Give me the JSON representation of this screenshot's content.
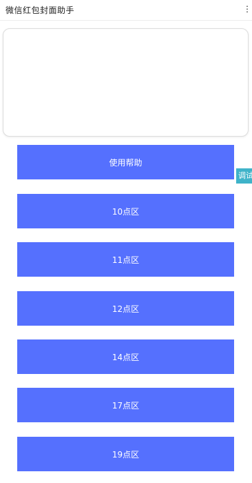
{
  "header": {
    "title": "微信红包封面助手",
    "more_glyph": "⋮"
  },
  "cover_preview": {},
  "buttons": [
    {
      "label": "使用帮助"
    },
    {
      "label": "10点区"
    },
    {
      "label": "11点区"
    },
    {
      "label": "12点区"
    },
    {
      "label": "14点区"
    },
    {
      "label": "17点区"
    },
    {
      "label": "19点区"
    }
  ],
  "debug_tab": {
    "label": "调试"
  },
  "colors": {
    "button_bg": "#5570fe",
    "debug_bg": "#3fb3c9"
  }
}
